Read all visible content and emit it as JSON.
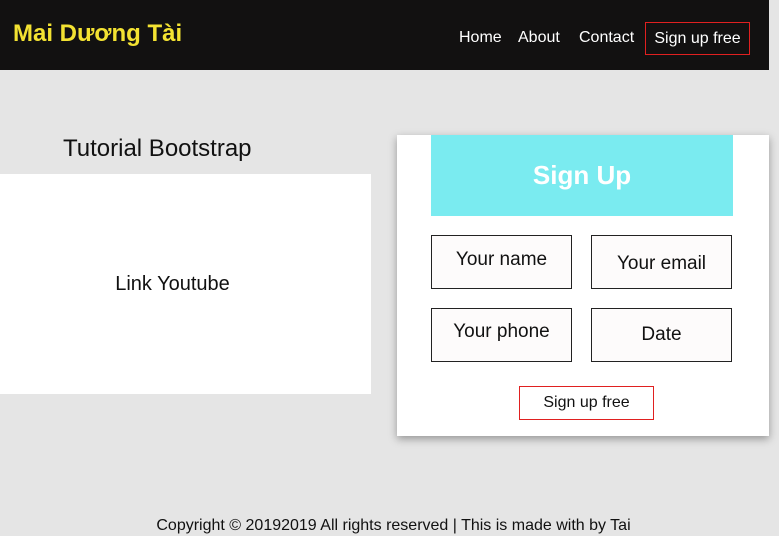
{
  "navbar": {
    "brand": "Mai Dương Tài",
    "links": [
      "Home",
      "About",
      "Contact"
    ],
    "signup_button": "Sign up free"
  },
  "main": {
    "title": "Tutorial Bootstrap",
    "video_link": "Link Youtube"
  },
  "signup_form": {
    "heading": "Sign Up",
    "fields": {
      "name_placeholder": "Your name",
      "email_placeholder": "Your email",
      "phone_placeholder": "Your phone",
      "date_placeholder": "Date"
    },
    "submit_label": "Sign up free"
  },
  "footer": {
    "text": "Copyright © 20192019 All rights reserved | This is made with by Tai"
  },
  "colors": {
    "navbar_bg": "#121111",
    "brand": "#f3e232",
    "header_cyan": "#7aebf0",
    "button_border": "#e02020",
    "page_bg": "#e5e5e5"
  }
}
